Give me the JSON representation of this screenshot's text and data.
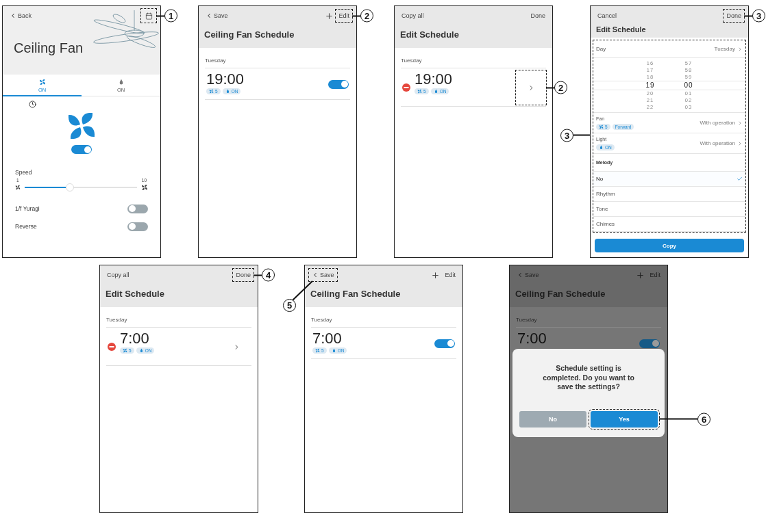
{
  "rows": [
    [
      {
        "kind": "device",
        "back": "Back",
        "calendar": {
          "callout": "1"
        },
        "title": "Ceiling Fan",
        "tabs": [
          {
            "kind": "fan",
            "label": "ON",
            "selected": true
          },
          {
            "kind": "light",
            "label": "ON",
            "selected": false
          }
        ],
        "power": {
          "on": true
        },
        "speed": {
          "label": "Speed",
          "min": "1",
          "max": "10",
          "level": 0.4
        },
        "toggles": [
          {
            "label": "1/f Yuragi",
            "on": false
          },
          {
            "label": "Reverse",
            "on": false
          }
        ]
      },
      {
        "kind": "list",
        "header": {
          "left": {
            "label": "Save",
            "chevron": true
          },
          "right": {
            "label": "Edit",
            "plus": true,
            "callout": "2"
          }
        },
        "title": "Ceiling Fan Schedule",
        "day": "Tuesday",
        "entries": [
          {
            "kind": "toggle",
            "time": "19:00",
            "removable": false,
            "enabled": true,
            "tags": [
              {
                "kind": "fan",
                "text": "5"
              },
              {
                "kind": "light",
                "text": "ON"
              }
            ]
          }
        ]
      },
      {
        "kind": "list",
        "header": {
          "left": {
            "label": "Copy all",
            "chevron": false
          },
          "right": {
            "label": "Done",
            "plus": false
          }
        },
        "title": "Edit Schedule",
        "day": "Tuesday",
        "entries": [
          {
            "kind": "chevron",
            "time": "19:00",
            "removable": true,
            "callout": "2",
            "tags": [
              {
                "kind": "fan",
                "text": "5"
              },
              {
                "kind": "light",
                "text": "ON"
              }
            ]
          }
        ]
      },
      {
        "kind": "detail",
        "header": {
          "left": {
            "label": "Cancel",
            "chevron": false
          },
          "right": {
            "label": "Done",
            "plus": false,
            "callout": "3"
          }
        },
        "title": "Edit Schedule",
        "form": {
          "callout": "3",
          "day": {
            "label": "Day",
            "value": "Tuesday"
          },
          "picker": [
            {
              "hour": "16",
              "minute": "57",
              "selected": false
            },
            {
              "hour": "17",
              "minute": "58",
              "selected": false
            },
            {
              "hour": "18",
              "minute": "59",
              "selected": false
            },
            {
              "hour": "19",
              "minute": "00",
              "selected": true
            },
            {
              "hour": "20",
              "minute": "01",
              "selected": false
            },
            {
              "hour": "21",
              "minute": "02",
              "selected": false
            },
            {
              "hour": "22",
              "minute": "03",
              "selected": false
            }
          ],
          "settings": [
            {
              "label": "Fan",
              "tags": [
                {
                  "kind": "fan",
                  "text": "5"
                },
                {
                  "kind": "text",
                  "text": "Forward"
                }
              ],
              "value": "With operation"
            },
            {
              "label": "Light",
              "tags": [
                {
                  "kind": "light",
                  "text": "ON"
                }
              ],
              "value": "With operation"
            }
          ],
          "melody": {
            "label": "Melody",
            "options": [
              {
                "label": "No",
                "selected": true
              },
              {
                "label": "Rhythm",
                "selected": false
              },
              {
                "label": "Tone",
                "selected": false
              },
              {
                "label": "Chimes",
                "selected": false
              }
            ]
          }
        },
        "button": "Copy"
      }
    ],
    [
      {
        "kind": "list",
        "header": {
          "left": {
            "label": "Copy all",
            "chevron": false
          },
          "right": {
            "label": "Done",
            "plus": false,
            "callout": "4"
          }
        },
        "title": "Edit Schedule",
        "day": "Tuesday",
        "entries": [
          {
            "kind": "chevron",
            "time": "7:00",
            "removable": true,
            "tags": [
              {
                "kind": "fan",
                "text": "5"
              },
              {
                "kind": "light",
                "text": "ON"
              }
            ]
          }
        ]
      },
      {
        "kind": "list",
        "header": {
          "left": {
            "label": "Save",
            "chevron": true,
            "callout": "5"
          },
          "right": {
            "label": "Edit",
            "plus": true
          }
        },
        "title": "Ceiling Fan Schedule",
        "day": "Tuesday",
        "entries": [
          {
            "kind": "toggle",
            "time": "7:00",
            "removable": false,
            "enabled": true,
            "tags": [
              {
                "kind": "fan",
                "text": "5"
              },
              {
                "kind": "light",
                "text": "ON"
              }
            ]
          }
        ]
      },
      {
        "kind": "list",
        "header": {
          "left": {
            "label": "Save",
            "chevron": true
          },
          "right": {
            "label": "Edit",
            "plus": true
          }
        },
        "title": "Ceiling Fan Schedule",
        "day": "Tuesday",
        "entries": [
          {
            "kind": "toggle",
            "time": "7:00",
            "removable": false,
            "enabled": true
          }
        ],
        "dialog": {
          "message": "Schedule setting is completed. Do you want to save the settings?",
          "buttons": [
            {
              "label": "No",
              "primary": false
            },
            {
              "label": "Yes",
              "primary": true,
              "callout": "6"
            }
          ]
        }
      }
    ]
  ]
}
